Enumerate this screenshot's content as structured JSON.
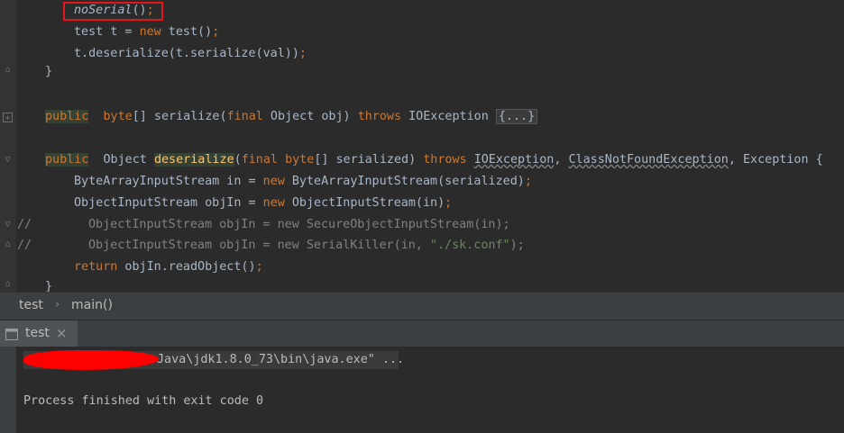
{
  "code": {
    "line1": {
      "call": "noSerial",
      "tail": "()",
      "semi": ";"
    },
    "line2": {
      "a": "test t = ",
      "kw": "new",
      "b": " test()",
      "semi": ";"
    },
    "line3": {
      "a": "t.deserialize(t.serialize(val))",
      "semi": ";"
    },
    "line4": {
      "brace": "}"
    },
    "line5": {
      "kw1": "public",
      "kw2": "byte",
      "a": "[] serialize(",
      "kw3": "final",
      "b": " Object obj) ",
      "kw4": "throws",
      "c": " IOException ",
      "fold": "{...}"
    },
    "line6": {
      "kw1": "public",
      "a": " Object ",
      "method": "deserialize",
      "b": "(",
      "kw2": "final",
      "kw3": "byte",
      "c": "[] serialized) ",
      "kw4": "throws",
      "e1": "IOException",
      "comma1": ", ",
      "e2": "ClassNotFoundException",
      "comma2": ", ",
      "e3": "Exception {"
    },
    "line7": {
      "a": "ByteArrayInputStream in = ",
      "kw": "new",
      "b": " ByteArrayInputStream(serialized)",
      "semi": ";"
    },
    "line8": {
      "a": "ObjectInputStream objIn = ",
      "kw": "new",
      "b": " ObjectInputStream(in)",
      "semi": ";"
    },
    "line9": {
      "prefix": "//",
      "text": "ObjectInputStream objIn = new SecureObjectInputStream(in);"
    },
    "line10": {
      "prefix": "//",
      "a": "ObjectInputStream objIn = new SerialKiller(in, ",
      "str": "\"./sk.conf\"",
      "b": ");"
    },
    "line11": {
      "kw": "return",
      "a": " objIn.readObject()",
      "semi": ";"
    },
    "line12": {
      "brace": "}"
    }
  },
  "breadcrumb": {
    "class": "test",
    "sep": "›",
    "method": "main()"
  },
  "run": {
    "tab_label": "test",
    "close": "×"
  },
  "console": {
    "cmd": "Java\\jdk1.8.0_73\\bin\\java.exe\" ...",
    "exit": "Process finished with exit code 0"
  }
}
